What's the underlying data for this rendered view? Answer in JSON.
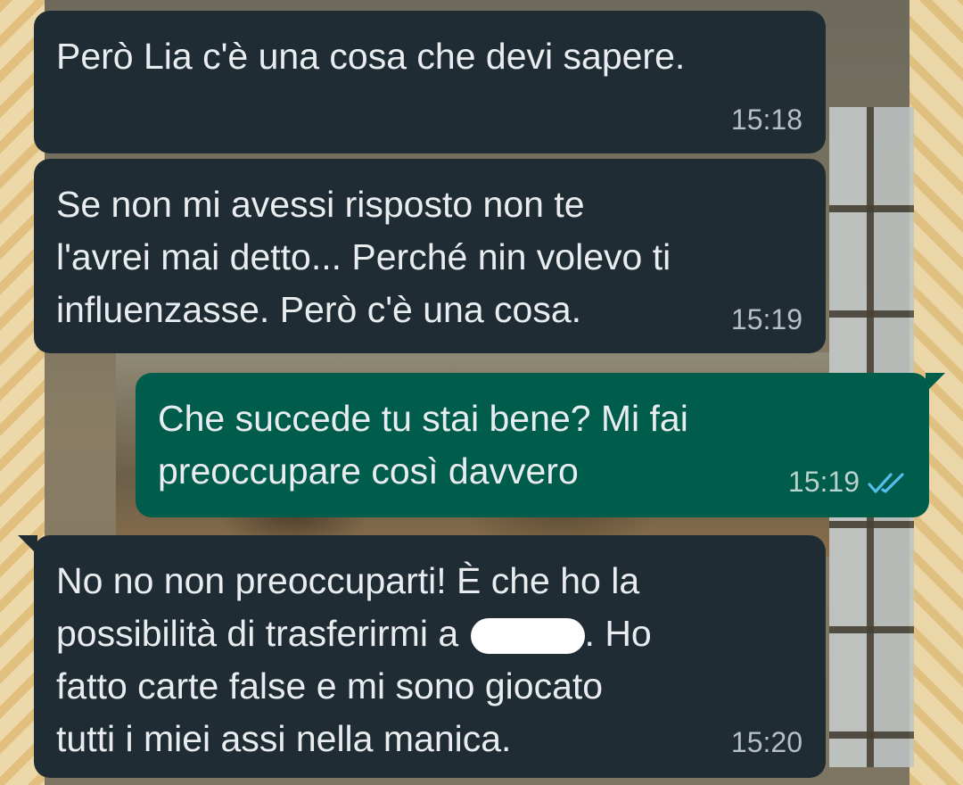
{
  "chat": {
    "messages": [
      {
        "direction": "incoming",
        "text": "Però Lia c'è una cosa che devi sapere.",
        "time": "15:18"
      },
      {
        "direction": "incoming",
        "text": "Se non mi avessi risposto non te\nl'avrei mai detto... Perché nin volevo ti\ninfluenzasse. Però c'è una cosa.",
        "time": "15:19"
      },
      {
        "direction": "outgoing",
        "text": "Che succede tu stai bene? Mi fai\npreoccupare così davvero",
        "time": "15:19",
        "status_icon": "double-check-read-icon"
      },
      {
        "direction": "incoming",
        "text_line1": "No no non preoccuparti! È che ho la",
        "text_line2_before": "possibilità di trasferirmi a ",
        "text_line2_after": ". Ho",
        "text_rest": "fatto carte false e mi sono giocato\ntutti i miei assi nella manica.",
        "time": "15:20",
        "redacted": true
      }
    ]
  },
  "colors": {
    "incoming_bubble": "#202c33",
    "outgoing_bubble": "#005c4b",
    "text": "#e9edef",
    "read_ticks": "#53bdeb"
  }
}
